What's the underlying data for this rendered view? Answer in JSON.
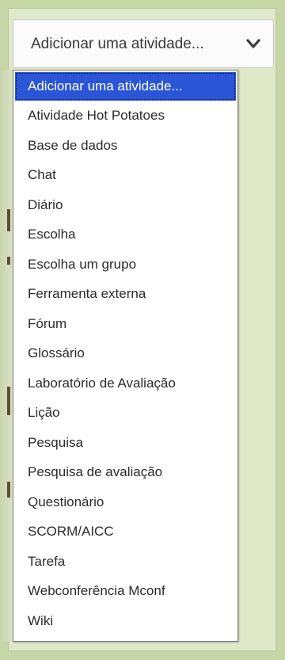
{
  "select": {
    "value": "Adicionar uma atividade...",
    "chevron_icon": "chevron-down-icon"
  },
  "dropdown": {
    "options": [
      "Adicionar uma atividade...",
      "Atividade Hot Potatoes",
      "Base de dados",
      "Chat",
      "Diário",
      "Escolha",
      "Escolha um grupo",
      "Ferramenta externa",
      "Fórum",
      "Glossário",
      "Laboratório de Avaliação",
      "Lição",
      "Pesquisa",
      "Pesquisa de avaliação",
      "Questionário",
      "SCORM/AICC",
      "Tarefa",
      "Webconferência Mconf",
      "Wiki"
    ],
    "selected_index": 0
  },
  "colors": {
    "background": "#c6d6a6",
    "highlight": "#2a55d6"
  }
}
